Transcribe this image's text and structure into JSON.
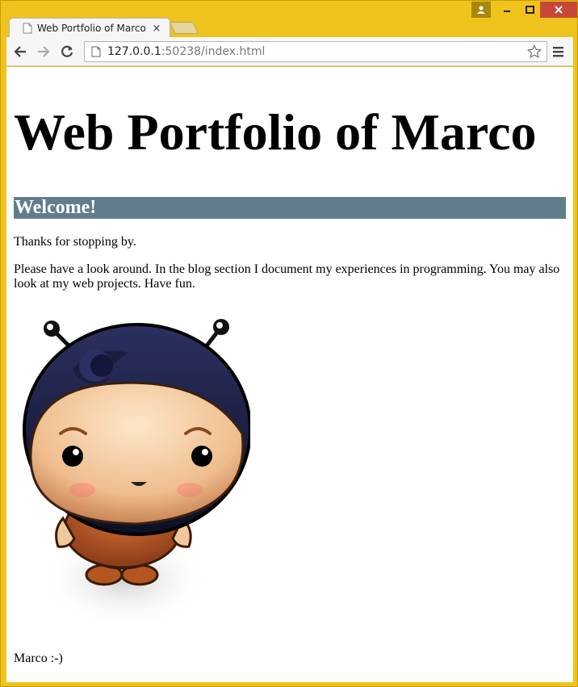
{
  "browser": {
    "tab": {
      "title": "Web Portfolio of Marco",
      "close_glyph": "×"
    },
    "address": {
      "host": "127.0.0.1",
      "rest": ":50238/index.html"
    }
  },
  "page": {
    "heading": "Web Portfolio of Marco",
    "section_title": "Welcome!",
    "paragraphs": [
      "Thanks for stopping by.",
      "Please have a look around. In the blog section I document my experiences in programming. You may also look at my web projects. Have fun."
    ],
    "signature": "Marco :-)"
  },
  "colors": {
    "frame": "#efc31c",
    "close_button": "#c7473a",
    "section_bar": "#607d8b"
  },
  "icons": [
    "user-icon",
    "minimize-icon",
    "maximize-icon",
    "close-icon",
    "page-icon",
    "back-icon",
    "forward-icon",
    "reload-icon",
    "star-icon",
    "menu-icon"
  ]
}
